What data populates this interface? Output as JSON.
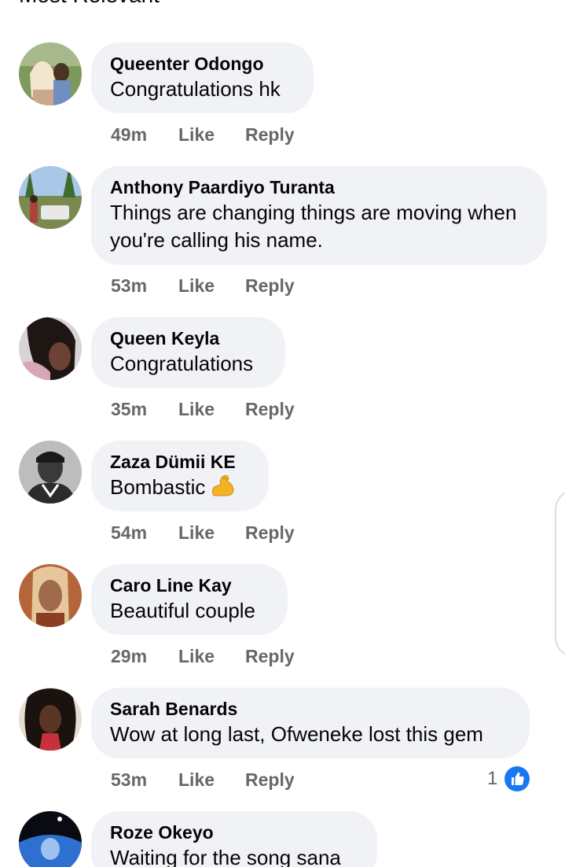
{
  "header": {
    "title": "Most Relevant"
  },
  "colors": {
    "bubble": "#f0f2f5",
    "meta": "#65676b",
    "like_blue": "#1877f2"
  },
  "comments": [
    {
      "author": "Queenter Odongo",
      "text": "Congratulations hk",
      "time": "49m",
      "like": "Like",
      "reply": "Reply"
    },
    {
      "author": "Anthony Paardiyo Turanta",
      "text": "Things are changing things are moving when you're calling his name.",
      "time": "53m",
      "like": "Like",
      "reply": "Reply"
    },
    {
      "author": "Queen Keyla",
      "text": "Congratulations",
      "time": "35m",
      "like": "Like",
      "reply": "Reply"
    },
    {
      "author": "Zaza Dümii KE",
      "text": "Bombastic",
      "emoji": "flexed-biceps-emoji",
      "time": "54m",
      "like": "Like",
      "reply": "Reply"
    },
    {
      "author": "Caro Line Kay",
      "text": "Beautiful couple",
      "time": "29m",
      "like": "Like",
      "reply": "Reply"
    },
    {
      "author": "Sarah Benards",
      "text": "Wow at long last, Ofweneke lost this  gem",
      "time": "53m",
      "like": "Like",
      "reply": "Reply",
      "reaction_count": "1",
      "reaction_icon": "thumbs-up-icon"
    },
    {
      "author": "Roze Okeyo",
      "text": "Waiting for the song sana"
    }
  ]
}
